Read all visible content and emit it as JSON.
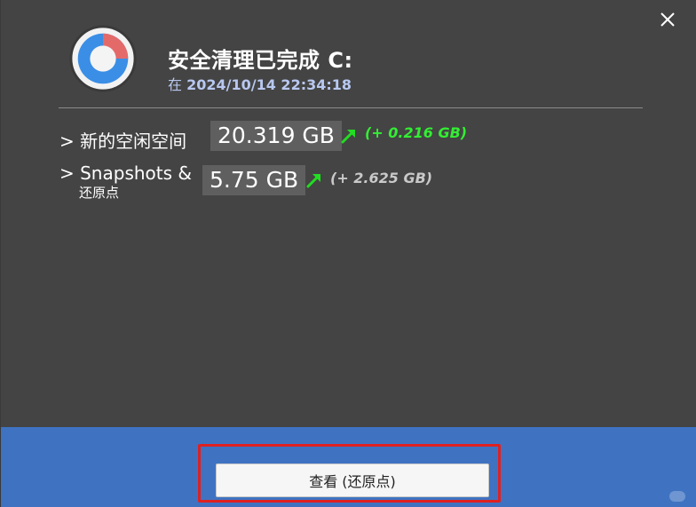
{
  "dialog": {
    "title": "安全清理已完成 C:",
    "subtitle_prefix": "在",
    "timestamp": "2024/10/14 22:34:18"
  },
  "rows": [
    {
      "label": "> 新的空闲空间",
      "sublabel": "",
      "value": "20.319 GB",
      "delta": "(+ 0.216 GB)",
      "delta_color": "#33ee33"
    },
    {
      "label": "> Snapshots &",
      "sublabel": "还原点",
      "value": "5.75 GB",
      "delta": "(+ 2.625 GB)",
      "delta_color": "#c9c9c9"
    }
  ],
  "footer": {
    "button_label": "查看 (还原点)"
  },
  "icons": {
    "close": "close-icon",
    "logo": "app-logo-icon",
    "arrow": "up-right-arrow-icon"
  },
  "colors": {
    "background": "#444444",
    "footer": "#3f73c2",
    "highlight": "#e02020",
    "arrow": "#22dd22",
    "subtitle": "#b8c8f0"
  }
}
